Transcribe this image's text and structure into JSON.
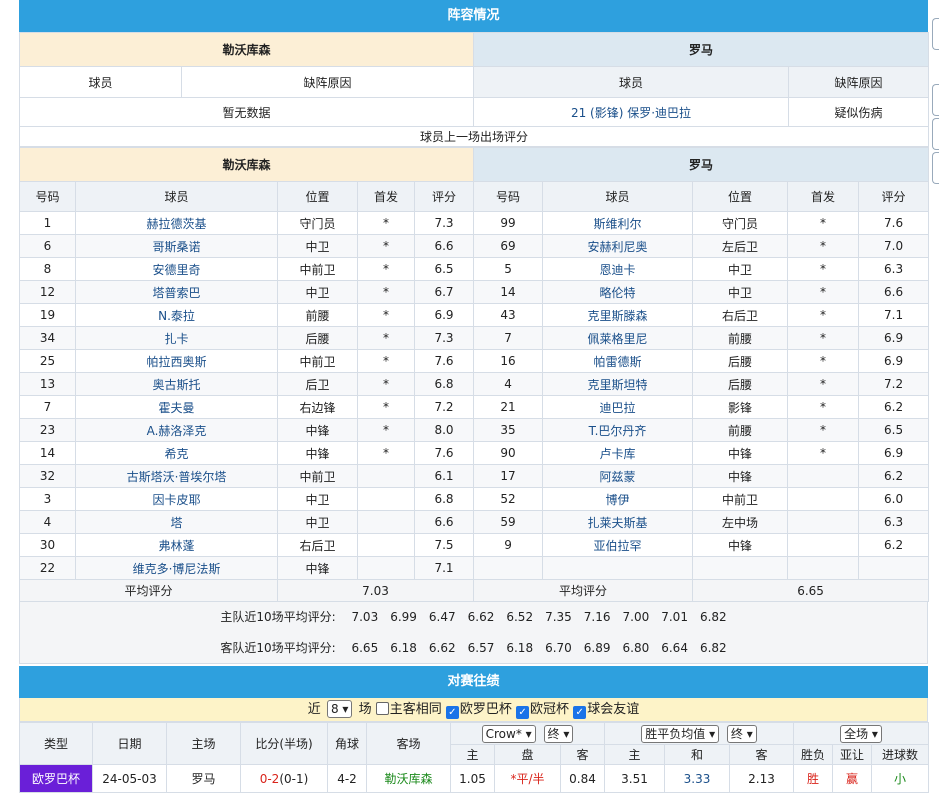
{
  "section_lineup": "阵容情况",
  "home_team": "勒沃库森",
  "away_team": "罗马",
  "col_player": "球员",
  "col_reason": "缺阵原因",
  "home_absent": "暂无数据",
  "away_absent_player": "21 (影锋) 保罗·迪巴拉",
  "away_absent_reason": "疑似伤病",
  "rating_caption": "球员上一场出场评分",
  "cols": [
    "号码",
    "球员",
    "位置",
    "首发",
    "评分"
  ],
  "home_players": [
    [
      "1",
      "赫拉德茨基",
      "守门员",
      "*",
      "7.3"
    ],
    [
      "6",
      "哥斯桑诺",
      "中卫",
      "*",
      "6.6"
    ],
    [
      "8",
      "安德里奇",
      "中前卫",
      "*",
      "6.5"
    ],
    [
      "12",
      "塔普索巴",
      "中卫",
      "*",
      "6.7"
    ],
    [
      "19",
      "N.泰拉",
      "前腰",
      "*",
      "6.9"
    ],
    [
      "34",
      "扎卡",
      "后腰",
      "*",
      "7.3"
    ],
    [
      "25",
      "帕拉西奥斯",
      "中前卫",
      "*",
      "7.6"
    ],
    [
      "13",
      "奥古斯托",
      "后卫",
      "*",
      "6.8"
    ],
    [
      "7",
      "霍夫曼",
      "右边锋",
      "*",
      "7.2"
    ],
    [
      "23",
      "A.赫洛泽克",
      "中锋",
      "*",
      "8.0"
    ],
    [
      "14",
      "希克",
      "中锋",
      "*",
      "7.6"
    ],
    [
      "32",
      "古斯塔沃·普埃尔塔",
      "中前卫",
      "",
      "6.1"
    ],
    [
      "3",
      "因卡皮耶",
      "中卫",
      "",
      "6.8"
    ],
    [
      "4",
      "塔",
      "中卫",
      "",
      "6.6"
    ],
    [
      "30",
      "弗林蓬",
      "右后卫",
      "",
      "7.5"
    ],
    [
      "22",
      "维克多·博尼法斯",
      "中锋",
      "",
      "7.1"
    ]
  ],
  "away_players": [
    [
      "99",
      "斯维利尔",
      "守门员",
      "*",
      "7.6"
    ],
    [
      "69",
      "安赫利尼奥",
      "左后卫",
      "*",
      "7.0"
    ],
    [
      "5",
      "恩迪卡",
      "中卫",
      "*",
      "6.3"
    ],
    [
      "14",
      "略伦特",
      "中卫",
      "*",
      "6.6"
    ],
    [
      "43",
      "克里斯滕森",
      "右后卫",
      "*",
      "7.1"
    ],
    [
      "7",
      "佩莱格里尼",
      "前腰",
      "*",
      "6.9"
    ],
    [
      "16",
      "帕雷德斯",
      "后腰",
      "*",
      "6.9"
    ],
    [
      "4",
      "克里斯坦特",
      "后腰",
      "*",
      "7.2"
    ],
    [
      "21",
      "迪巴拉",
      "影锋",
      "*",
      "6.2"
    ],
    [
      "35",
      "T.巴尔丹齐",
      "前腰",
      "*",
      "6.5"
    ],
    [
      "90",
      "卢卡库",
      "中锋",
      "*",
      "6.9"
    ],
    [
      "17",
      "阿兹蒙",
      "中锋",
      "",
      "6.2"
    ],
    [
      "52",
      "博伊",
      "中前卫",
      "",
      "6.0"
    ],
    [
      "59",
      "扎莱夫斯基",
      "左中场",
      "",
      "6.3"
    ],
    [
      "9",
      "亚伯拉罕",
      "中锋",
      "",
      "6.2"
    ],
    [
      "",
      "",
      "",
      "",
      ""
    ]
  ],
  "avg_label": "平均评分",
  "home_avg": "7.03",
  "away_avg": "6.65",
  "home_recent_label": "主队近10场平均评分:",
  "home_recent": [
    "7.03",
    "6.99",
    "6.47",
    "6.62",
    "6.52",
    "7.35",
    "7.16",
    "7.00",
    "7.01",
    "6.82"
  ],
  "away_recent_label": "客队近10场平均评分:",
  "away_recent": [
    "6.65",
    "6.18",
    "6.62",
    "6.57",
    "6.18",
    "6.70",
    "6.89",
    "6.80",
    "6.64",
    "6.82"
  ],
  "section_h2h": "对赛往绩",
  "filter": {
    "near": "近",
    "count": "8",
    "unit": "场",
    "same": "主客相同",
    "c1": "欧罗巴杯",
    "c2": "欧冠杯",
    "c3": "球会友谊"
  },
  "hist_cols": {
    "type": "类型",
    "date": "日期",
    "home": "主场",
    "score": "比分(半场)",
    "corner": "角球",
    "away": "客场",
    "sel1": "Crow*",
    "sel2": "终",
    "sel3": "胜平负均值",
    "sel4": "终",
    "sel5": "全场",
    "h1": "主",
    "h2": "盘",
    "h3": "客",
    "h4": "主",
    "h5": "和",
    "h6": "客",
    "h7": "胜负",
    "h8": "亚让",
    "h9": "进球数"
  },
  "hist_row": {
    "type": "欧罗巴杯",
    "date": "24-05-03",
    "home": "罗马",
    "score": "0-2",
    "half": "(0-1)",
    "corner": "4-2",
    "away": "勒沃库森",
    "o1": "1.05",
    "o2": "*平/半",
    "o3": "0.84",
    "o4": "3.51",
    "o5": "3.33",
    "o6": "2.13",
    "r1": "胜",
    "r2": "赢",
    "r3": "小"
  },
  "colors": {
    "bar": "#2ea0de",
    "home_head": "#fcefd6",
    "away_head": "#dce8f1",
    "tag": "#6a1fd8"
  }
}
